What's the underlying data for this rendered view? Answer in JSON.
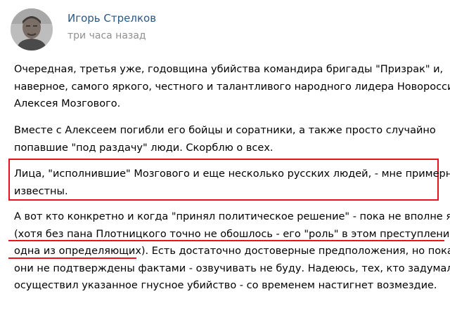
{
  "header": {
    "author_name": "Игорь Стрелков",
    "timestamp": "три часа назад"
  },
  "body": {
    "p1_l1": "Очередная, третья уже, годовщина убийства командира бригады \"Призрак\" и,",
    "p1_l2": "наверное, самого яркого, честного и талантливого народного лидера Новороссии -",
    "p1_l3": "Алексея Мозгового.",
    "p2_l1": "Вместе с Алексеем погибли его бойцы и соратники, а также просто случайно",
    "p2_l2": "попавшие \"под раздачу\" люди. Скорблю о всех.",
    "p3_l1": "Лица, \"исполнившие\" Мозгового и еще несколько русских людей, - мне примерно",
    "p3_l2": "известны.",
    "p4_l1": "А вот кто конкретно и когда \"принял политическое решение\" - пока не вполне ясно",
    "p4_l2": "(хотя без пана Плотницкого точно не обошлось - его \"роль\" в этом преступлении -",
    "p4_l3": "одна из определяющих). Есть достаточно достоверные предположения, но пока",
    "p4_l4": "они не подтверждены фактами - озвучивать не буду. Надеюсь, тех, кто задумал и",
    "p4_l5": "осуществил указанное гнусное убийство - со временем настигнет возмездие."
  },
  "annotations": {
    "highlight_color": "#e8131b",
    "author_link_color": "#2a5885",
    "timestamp_color": "#909090"
  }
}
